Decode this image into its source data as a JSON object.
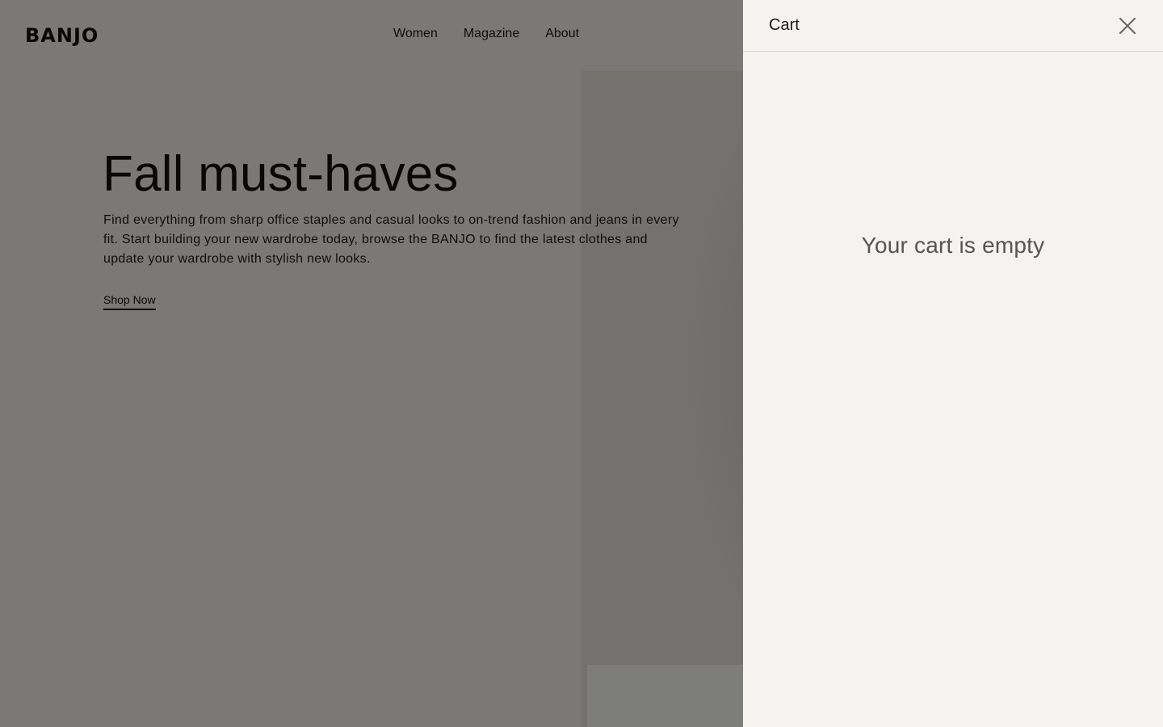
{
  "header": {
    "brand": "BANJO",
    "nav": [
      {
        "label": "Women"
      },
      {
        "label": "Magazine"
      },
      {
        "label": "About"
      }
    ]
  },
  "hero": {
    "title": "Fall must-haves",
    "description": "Find everything from sharp office staples and casual looks to on-trend fashion and jeans in every fit. Start building your new wardrobe today, browse the BANJO to find the latest clothes and update your wardrobe with stylish new looks.",
    "cta_label": "Shop Now"
  },
  "cart": {
    "title": "Cart",
    "close_icon": "close-icon",
    "empty_message": "Your cart is empty"
  },
  "colors": {
    "background": "#f4f3ef",
    "text": "#111111",
    "overlay": "rgba(0,0,0,0.5)",
    "muted_text": "#555555"
  }
}
